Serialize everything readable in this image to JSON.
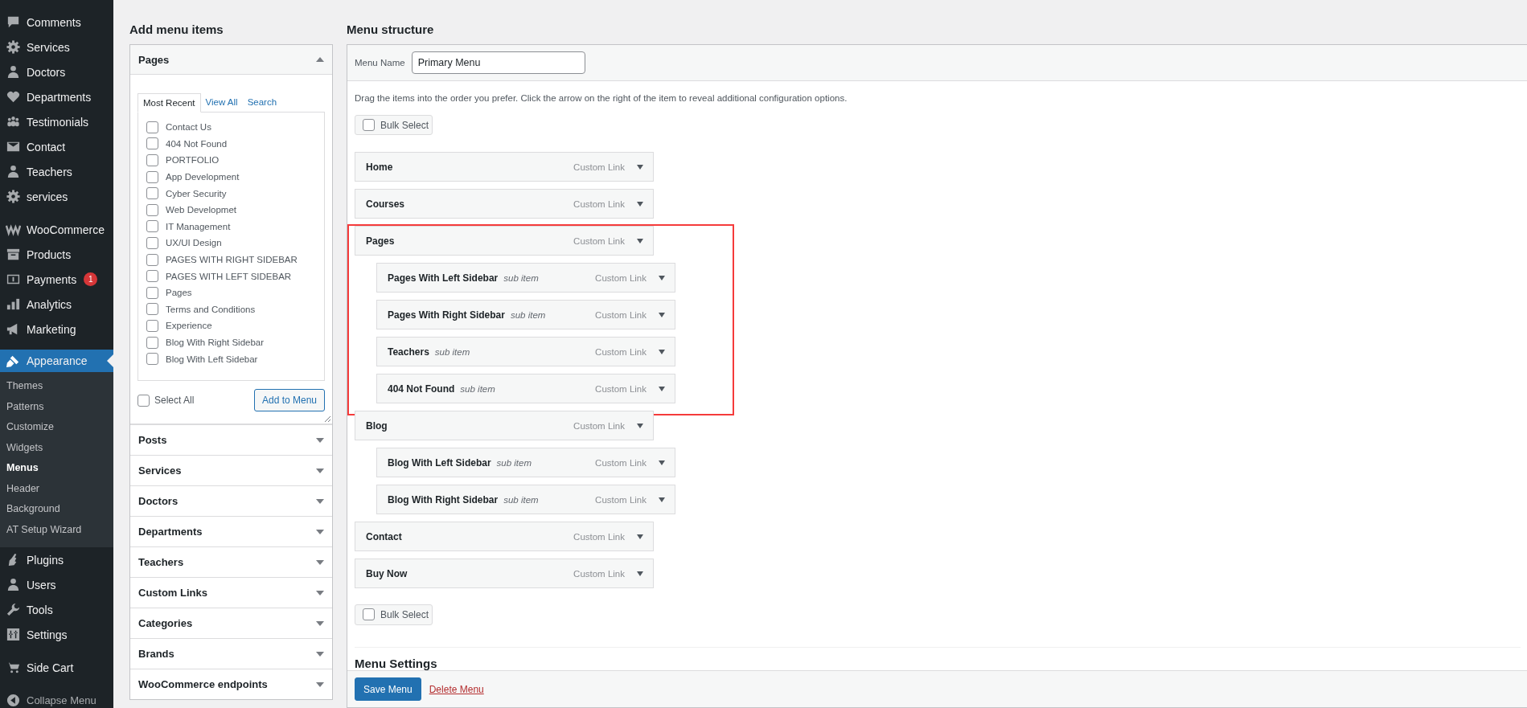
{
  "sidebar": {
    "groups": [
      [
        {
          "label": "Comments",
          "selected": false
        },
        {
          "label": "Services",
          "selected": false
        },
        {
          "label": "Doctors",
          "selected": false
        },
        {
          "label": "Departments",
          "selected": false
        },
        {
          "label": "Testimonials",
          "selected": false
        },
        {
          "label": "Contact",
          "selected": false
        },
        {
          "label": "Teachers",
          "selected": false
        },
        {
          "label": "services",
          "selected": false
        }
      ],
      [
        {
          "label": "WooCommerce",
          "selected": false
        },
        {
          "label": "Products",
          "selected": false
        },
        {
          "label": "Payments",
          "selected": false,
          "badge": "1"
        },
        {
          "label": "Analytics",
          "selected": false
        },
        {
          "label": "Marketing",
          "selected": false
        }
      ],
      [
        {
          "label": "Appearance",
          "selected": true,
          "submenu": [
            {
              "label": "Themes",
              "selected": false
            },
            {
              "label": "Patterns",
              "selected": false
            },
            {
              "label": "Customize",
              "selected": false
            },
            {
              "label": "Widgets",
              "selected": false
            },
            {
              "label": "Menus",
              "selected": true
            },
            {
              "label": "Header",
              "selected": false
            },
            {
              "label": "Background",
              "selected": false
            },
            {
              "label": "AT Setup Wizard",
              "selected": false
            }
          ]
        },
        {
          "label": "Plugins",
          "selected": false
        },
        {
          "label": "Users",
          "selected": false
        },
        {
          "label": "Tools",
          "selected": false
        },
        {
          "label": "Settings",
          "selected": false
        }
      ],
      [
        {
          "label": "Side Cart",
          "selected": false
        }
      ]
    ],
    "collapse_label": "Collapse Menu"
  },
  "add_items": {
    "title": "Add menu items",
    "sections": [
      {
        "title": "Pages",
        "expanded": true,
        "tabs": [
          {
            "label": "Most Recent",
            "selected": true
          },
          {
            "label": "View All",
            "selected": false
          },
          {
            "label": "Search",
            "selected": false
          }
        ],
        "items": [
          {
            "label": "Contact Us",
            "checked": false
          },
          {
            "label": "404 Not Found",
            "checked": false
          },
          {
            "label": "PORTFOLIO",
            "checked": false
          },
          {
            "label": "App Development",
            "checked": false
          },
          {
            "label": "Cyber Security",
            "checked": false
          },
          {
            "label": "Web Developmet",
            "checked": false
          },
          {
            "label": "IT Management",
            "checked": false
          },
          {
            "label": "UX/UI Design",
            "checked": false
          },
          {
            "label": "PAGES WITH RIGHT SIDEBAR",
            "checked": false
          },
          {
            "label": "PAGES WITH LEFT SIDEBAR",
            "checked": false
          },
          {
            "label": "Pages",
            "checked": false
          },
          {
            "label": "Terms and Conditions",
            "checked": false
          },
          {
            "label": "Experience",
            "checked": false
          },
          {
            "label": "Blog With Right Sidebar",
            "checked": false
          },
          {
            "label": "Blog With Left Sidebar",
            "checked": false
          }
        ],
        "select_all": {
          "label": "Select All",
          "checked": false
        },
        "button": "Add to Menu"
      },
      {
        "title": "Posts",
        "expanded": false
      },
      {
        "title": "Services",
        "expanded": false
      },
      {
        "title": "Doctors",
        "expanded": false
      },
      {
        "title": "Departments",
        "expanded": false
      },
      {
        "title": "Teachers",
        "expanded": false
      },
      {
        "title": "Custom Links",
        "expanded": false
      },
      {
        "title": "Categories",
        "expanded": false
      },
      {
        "title": "Brands",
        "expanded": false
      },
      {
        "title": "WooCommerce endpoints",
        "expanded": false
      }
    ]
  },
  "menu": {
    "title": "Menu structure",
    "name_label": "Menu Name",
    "name_value": "Primary Menu",
    "instructions": "Drag the items into the order you prefer. Click the arrow on the right of the item to reveal additional configuration options.",
    "bulk_select": [
      {
        "label": "Bulk Select",
        "checked": false
      },
      {
        "label": "Bulk Select",
        "checked": false
      }
    ],
    "items": [
      {
        "title": "Home",
        "type": "Custom Link",
        "highlighted": false
      },
      {
        "title": "Courses",
        "type": "Custom Link",
        "highlighted": false
      },
      {
        "title": "Pages",
        "type": "Custom Link",
        "highlighted": true,
        "children": [
          {
            "title": "Pages With Left Sidebar",
            "note": "sub item",
            "type": "Custom Link"
          },
          {
            "title": "Pages With Right Sidebar",
            "note": "sub item",
            "type": "Custom Link"
          },
          {
            "title": "Teachers",
            "note": "sub item",
            "type": "Custom Link"
          },
          {
            "title": "404 Not Found",
            "note": "sub item",
            "type": "Custom Link"
          }
        ]
      },
      {
        "title": "Blog",
        "type": "Custom Link",
        "highlighted": false,
        "children": [
          {
            "title": "Blog With Left Sidebar",
            "note": "sub item",
            "type": "Custom Link"
          },
          {
            "title": "Blog With Right Sidebar",
            "note": "sub item",
            "type": "Custom Link"
          }
        ]
      },
      {
        "title": "Contact",
        "type": "Custom Link",
        "highlighted": false
      },
      {
        "title": "Buy Now",
        "type": "Custom Link",
        "highlighted": false
      }
    ],
    "settings_title": "Menu Settings",
    "save": "Save Menu",
    "delete": "Delete Menu"
  }
}
